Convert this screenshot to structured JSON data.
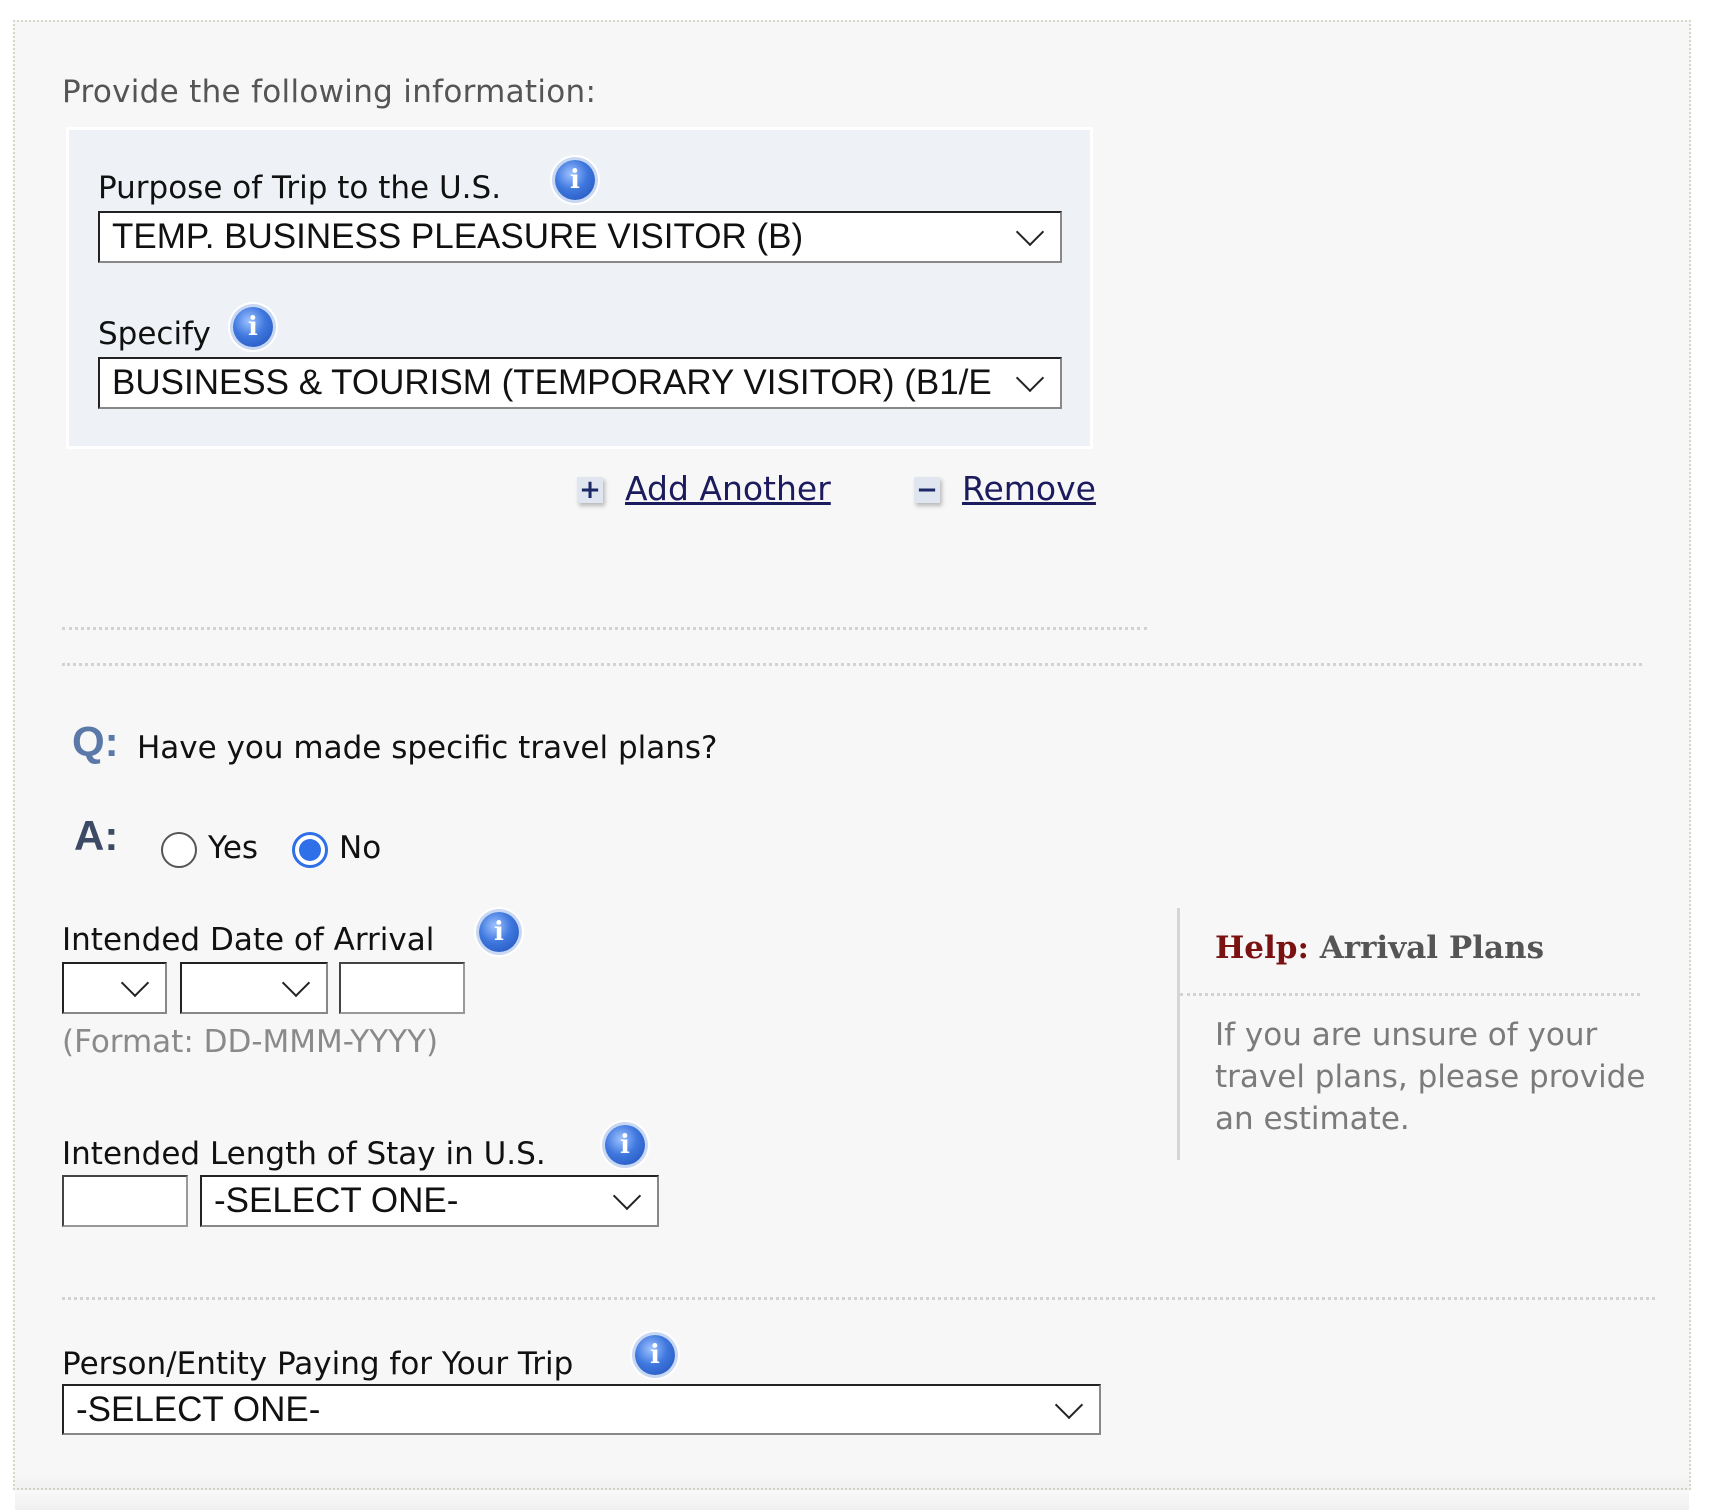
{
  "intro": "Provide the following information:",
  "purpose_section": {
    "purpose_label": "Purpose of Trip to the U.S.",
    "purpose_value": "TEMP. BUSINESS PLEASURE VISITOR (B)",
    "specify_label": "Specify",
    "specify_value": "BUSINESS & TOURISM (TEMPORARY VISITOR) (B1/E",
    "add_another": "Add Another",
    "remove": "Remove"
  },
  "travel_plans": {
    "q_marker": "Q:",
    "question": "Have you made specific travel plans?",
    "a_marker": "A:",
    "options": [
      {
        "label": "Yes",
        "checked": false
      },
      {
        "label": "No",
        "checked": true
      }
    ]
  },
  "arrival": {
    "label": "Intended Date of Arrival",
    "day_value": "",
    "month_value": "",
    "year_value": "",
    "format_hint": "(Format: DD-MMM-YYYY)"
  },
  "stay": {
    "label": "Intended Length of Stay in U.S.",
    "length_value": "",
    "unit_value": "-SELECT ONE-"
  },
  "payer": {
    "label": "Person/Entity Paying for Your Trip",
    "value": "-SELECT ONE-"
  },
  "help": {
    "prefix": "Help:",
    "title": "Arrival Plans",
    "body": "If you are unsure of your travel plans, please provide an estimate."
  },
  "colors": {
    "help_prefix": "#7a1212",
    "radio_accent": "#2f6fe8",
    "link": "#1b1b5e",
    "panel_bg": "#eef2f6"
  },
  "icons": {
    "info": "info-icon",
    "plus": "plus-icon",
    "minus": "minus-icon",
    "chevron": "chevron-down-icon"
  }
}
